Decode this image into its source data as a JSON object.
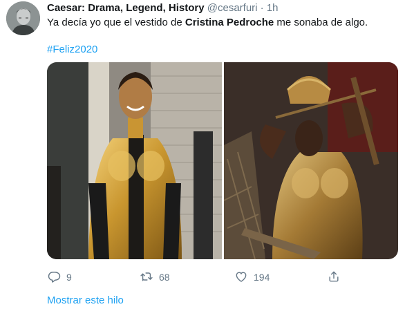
{
  "tweet": {
    "author_name": "Caesar: Drama, Legend, History",
    "handle": "@cesarfuri",
    "separator": "·",
    "time": "1h",
    "text_before": "Ya decía yo que el vestido de ",
    "text_bold": "Cristina Pedroche",
    "text_after": " me sonaba de algo.",
    "hashtag": "#Feliz2020"
  },
  "actions": {
    "reply_count": "9",
    "retweet_count": "68",
    "like_count": "194"
  },
  "show_thread_label": "Mostrar este hilo",
  "colors": {
    "link_blue": "#1da1f2",
    "secondary_gray": "#657786",
    "text_dark": "#14171a"
  },
  "icons": [
    "reply-icon",
    "retweet-icon",
    "like-icon",
    "share-icon"
  ]
}
